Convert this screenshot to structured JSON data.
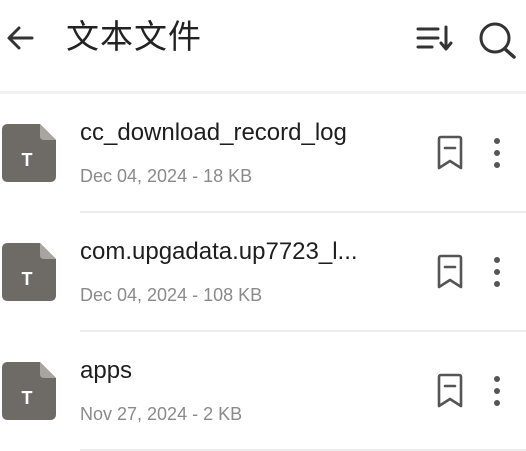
{
  "header": {
    "title": "文本文件",
    "back_icon": "arrow-left-icon",
    "sort_icon": "sort-icon",
    "search_icon": "search-icon"
  },
  "files": [
    {
      "name": "cc_download_record_log",
      "meta": "Dec 04, 2024 - 18 KB",
      "type_letter": "T"
    },
    {
      "name": "com.upgadata.up7723_l...",
      "meta": "Dec 04, 2024 - 108 KB",
      "type_letter": "T"
    },
    {
      "name": "apps",
      "meta": "Nov 27, 2024 - 2 KB",
      "type_letter": "T"
    }
  ],
  "colors": {
    "file_icon": "#6e6a66",
    "file_icon_fold": "#a8a4a0",
    "icon_stroke": "#555555"
  }
}
